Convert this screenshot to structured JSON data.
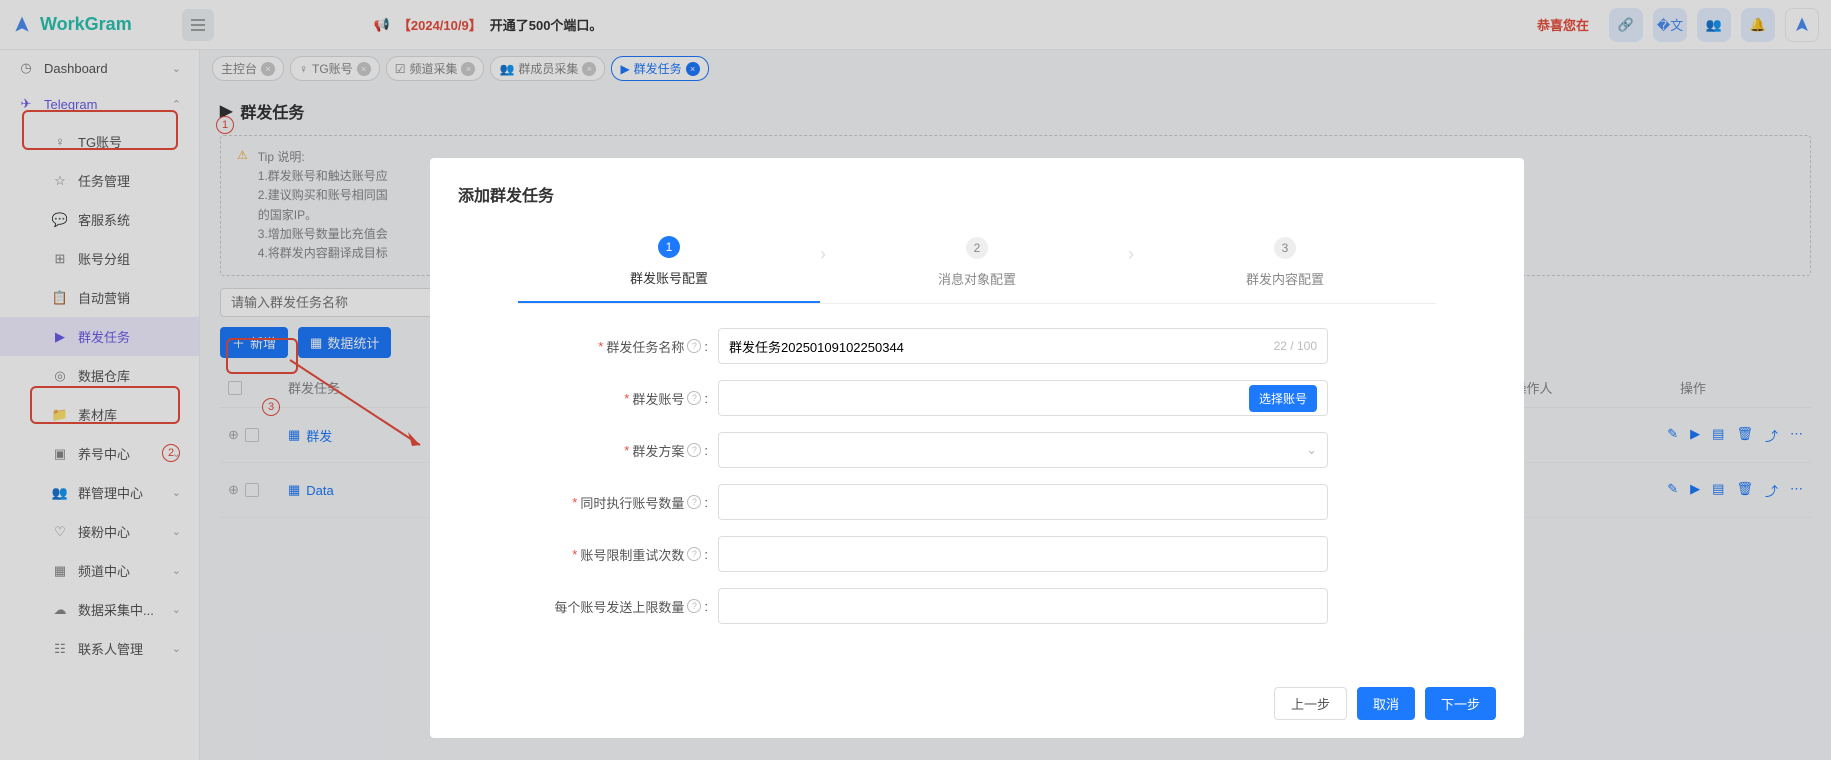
{
  "header": {
    "brand": "WorkGram",
    "announcement_date": "【2024/10/9】",
    "announcement_text": "开通了500个端口。",
    "congrats": "恭喜您在"
  },
  "sidebar": {
    "dashboard": "Dashboard",
    "telegram": "Telegram",
    "items": [
      "TG账号",
      "任务管理",
      "客服系统",
      "账号分组",
      "自动营销",
      "群发任务",
      "数据仓库",
      "素材库",
      "养号中心",
      "群管理中心",
      "接粉中心",
      "频道中心",
      "数据采集中...",
      "联系人管理"
    ]
  },
  "tabs": [
    "主控台",
    "TG账号",
    "频道采集",
    "群成员采集",
    "群发任务"
  ],
  "page": {
    "title": "群发任务",
    "tip_title": "Tip 说明:",
    "tip_lines": [
      "1.群发账号和触达账号应",
      "2.建议购买和账号相同国",
      "的国家IP。",
      "3.增加账号数量比充值会",
      "4.将群发内容翻译成目标"
    ],
    "search_placeholder": "请输入群发任务名称",
    "btn_add": "新增",
    "btn_stats": "数据统计",
    "th_name": "群发任务",
    "th_operator": "操作人",
    "th_actions": "操作",
    "rows": [
      {
        "name": "群发"
      },
      {
        "name": "Data"
      }
    ]
  },
  "modal": {
    "title": "添加群发任务",
    "steps": [
      "群发账号配置",
      "消息对象配置",
      "群发内容配置"
    ],
    "fields": {
      "task_name_label": "群发任务名称",
      "task_name_value": "群发任务20250109102250344",
      "task_name_counter": "22 / 100",
      "account_label": "群发账号",
      "account_select_btn": "选择账号",
      "plan_label": "群发方案",
      "concurrent_label": "同时执行账号数量",
      "retry_label": "账号限制重试次数",
      "limit_label": "每个账号发送上限数量"
    },
    "footer": {
      "prev": "上一步",
      "cancel": "取消",
      "next": "下一步"
    }
  }
}
